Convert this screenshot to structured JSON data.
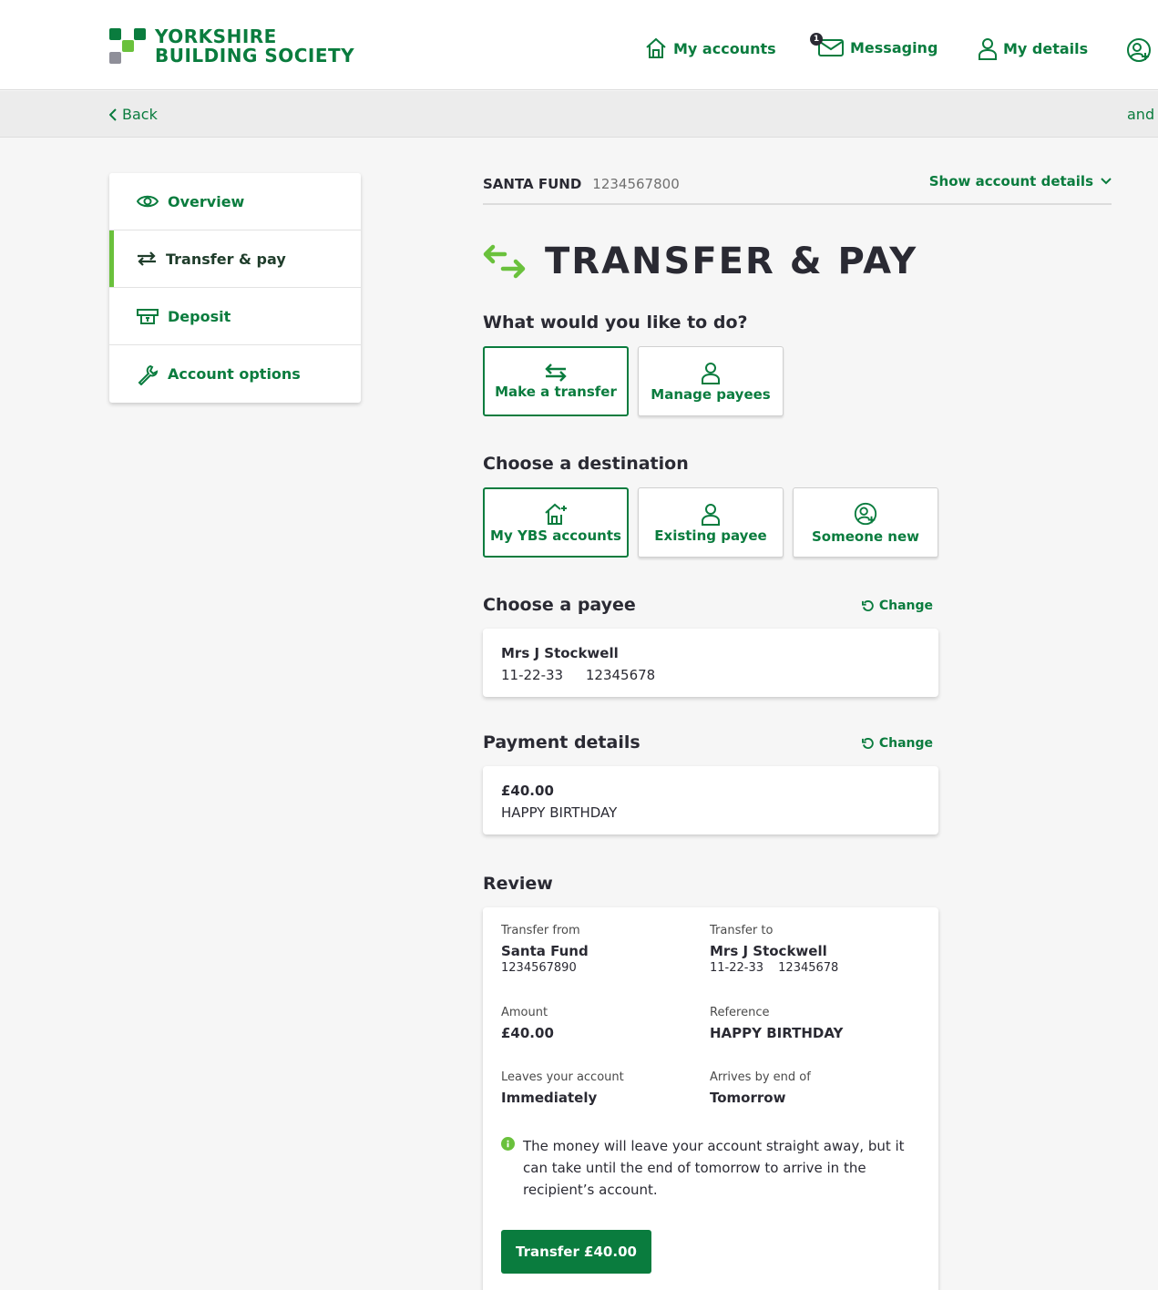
{
  "brand": {
    "line1": "YORKSHIRE",
    "line2": "BUILDING SOCIETY",
    "colors": {
      "primary": "#0a7c3e",
      "accent": "#6ac13c",
      "grey": "#8f8f99"
    }
  },
  "nav": {
    "my_accounts": "My accounts",
    "messaging": "Messaging",
    "messaging_badge": "1",
    "my_details": "My details",
    "extra_icon": "user-plus-icon"
  },
  "subbar": {
    "back": "Back",
    "right_text": "and s"
  },
  "sidebar": {
    "items": [
      {
        "label": "Overview",
        "icon": "eye-icon"
      },
      {
        "label": "Transfer & pay",
        "icon": "transfer-icon"
      },
      {
        "label": "Deposit",
        "icon": "deposit-icon"
      },
      {
        "label": "Account options",
        "icon": "wrench-icon"
      }
    ]
  },
  "account": {
    "name": "SANTA FUND",
    "number": "1234567800",
    "show_details": "Show account details"
  },
  "page": {
    "title": "TRANSFER & PAY"
  },
  "what_to_do": {
    "heading": "What would you like to do?",
    "options": [
      "Make a transfer",
      "Manage payees"
    ]
  },
  "destination": {
    "heading": "Choose a destination",
    "options": [
      "My YBS accounts",
      "Existing payee",
      "Someone new"
    ]
  },
  "payee": {
    "heading": "Choose a payee",
    "change": "Change",
    "name": "Mrs J Stockwell",
    "sort_code": "11-22-33",
    "account_number": "12345678"
  },
  "payment": {
    "heading": "Payment details",
    "change": "Change",
    "amount": "£40.00",
    "reference": "HAPPY BIRTHDAY"
  },
  "review": {
    "heading": "Review",
    "transfer_from_label": "Transfer from",
    "transfer_from_name": "Santa Fund",
    "transfer_from_number": "1234567890",
    "transfer_to_label": "Transfer to",
    "transfer_to_name": "Mrs J Stockwell",
    "transfer_to_sort": "11-22-33",
    "transfer_to_number": "12345678",
    "amount_label": "Amount",
    "amount_value": "£40.00",
    "reference_label": "Reference",
    "reference_value": "HAPPY BIRTHDAY",
    "leaves_label": "Leaves your account",
    "leaves_value": "Immediately",
    "arrives_label": "Arrives by end of",
    "arrives_value": "Tomorrow",
    "info": "The money will leave your account straight away, but it can take until the end of tomorrow to arrive in the recipient’s account.",
    "button": "Transfer £40.00"
  }
}
